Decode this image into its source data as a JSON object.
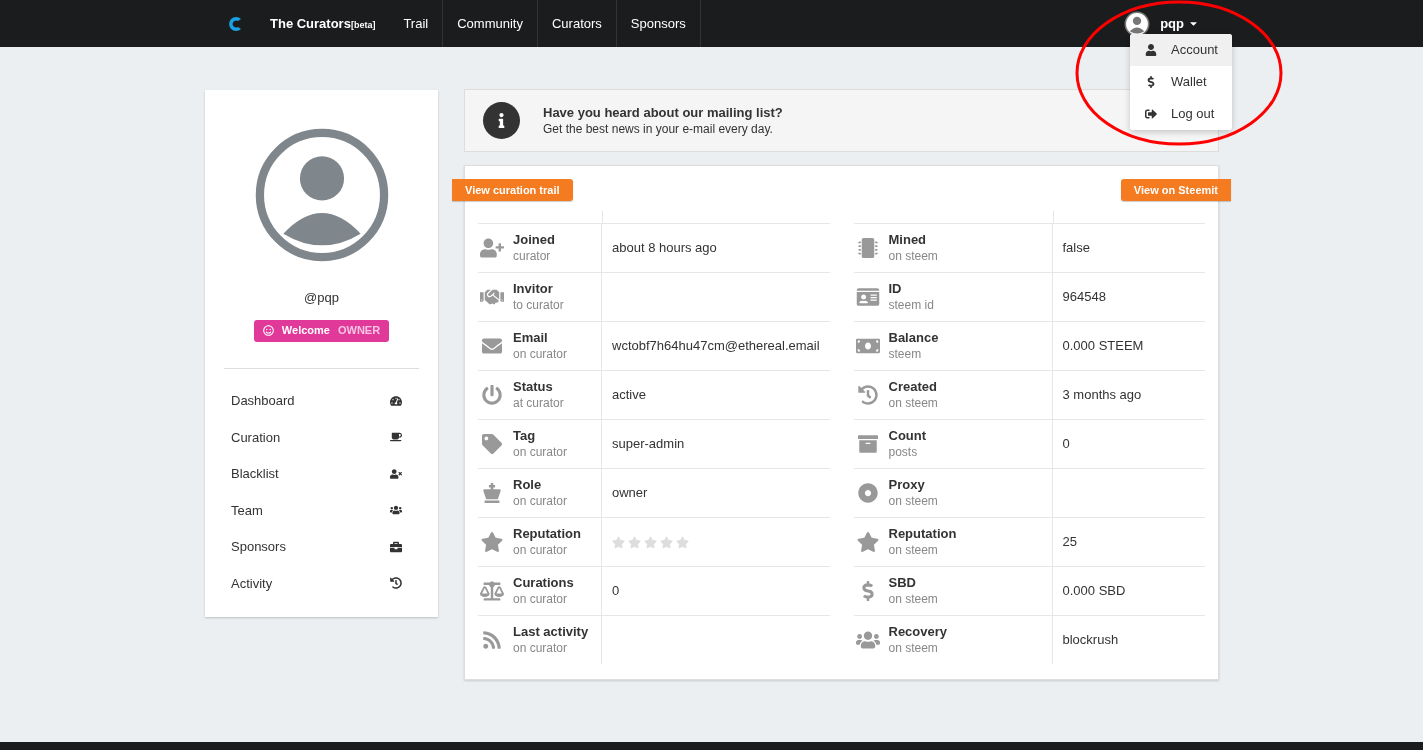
{
  "navbar": {
    "brand": "The Curators",
    "brand_tag": "[beta]",
    "links": [
      "Trail",
      "Community",
      "Curators",
      "Sponsors"
    ],
    "user": "pqp",
    "menu": [
      {
        "label": "Account",
        "selected": true
      },
      {
        "label": "Wallet",
        "selected": false
      },
      {
        "label": "Log out",
        "selected": false
      }
    ]
  },
  "profile": {
    "username": "@pqp",
    "badge": {
      "label": "Welcome",
      "role": "OWNER"
    },
    "nav": [
      "Dashboard",
      "Curation",
      "Blacklist",
      "Team",
      "Sponsors",
      "Activity"
    ]
  },
  "notice": {
    "title": "Have you heard about our mailing list?",
    "text": "Get the best news in your e-mail every day."
  },
  "details": {
    "left_button": "View curation trail",
    "right_button": "View on Steemit",
    "left_rows": [
      {
        "label": "Joined",
        "sub": "curator",
        "kind": "text",
        "value": "about 8 hours ago"
      },
      {
        "label": "Invitor",
        "sub": "to curator",
        "kind": "text"
      },
      {
        "label": "Email",
        "sub": "on curator",
        "kind": "text",
        "value": "wctobf7h64hu47cm@ethereal.email"
      },
      {
        "label": "Status",
        "sub": "at curator",
        "kind": "text",
        "value": "active"
      },
      {
        "label": "Tag",
        "sub": "on curator",
        "kind": "text",
        "value": "super-admin"
      },
      {
        "label": "Role",
        "sub": "on curator",
        "kind": "text",
        "value": "owner"
      },
      {
        "label": "Reputation",
        "sub": "on curator",
        "kind": "stars",
        "stars": 0
      },
      {
        "label": "Curations",
        "sub": "on curator",
        "kind": "text",
        "value": "0"
      },
      {
        "label": "Last activity",
        "sub": "on curator",
        "kind": "text"
      }
    ],
    "right_rows": [
      {
        "label": "Mined",
        "sub": "on steem",
        "kind": "text",
        "value": "false"
      },
      {
        "label": "ID",
        "sub": "steem id",
        "kind": "text",
        "value": "964548"
      },
      {
        "label": "Balance",
        "sub": "steem",
        "kind": "text",
        "value": "0.000 STEEM"
      },
      {
        "label": "Created",
        "sub": "on steem",
        "kind": "text",
        "value": "3 months ago"
      },
      {
        "label": "Count",
        "sub": "posts",
        "kind": "text",
        "value": "0"
      },
      {
        "label": "Proxy",
        "sub": "on steem",
        "kind": "text"
      },
      {
        "label": "Reputation",
        "sub": "on steem",
        "kind": "text",
        "value": "25"
      },
      {
        "label": "SBD",
        "sub": "on steem",
        "kind": "text",
        "value": "0.000 SBD"
      },
      {
        "label": "Recovery",
        "sub": "on steem",
        "kind": "text",
        "value": "blockrush"
      }
    ]
  }
}
